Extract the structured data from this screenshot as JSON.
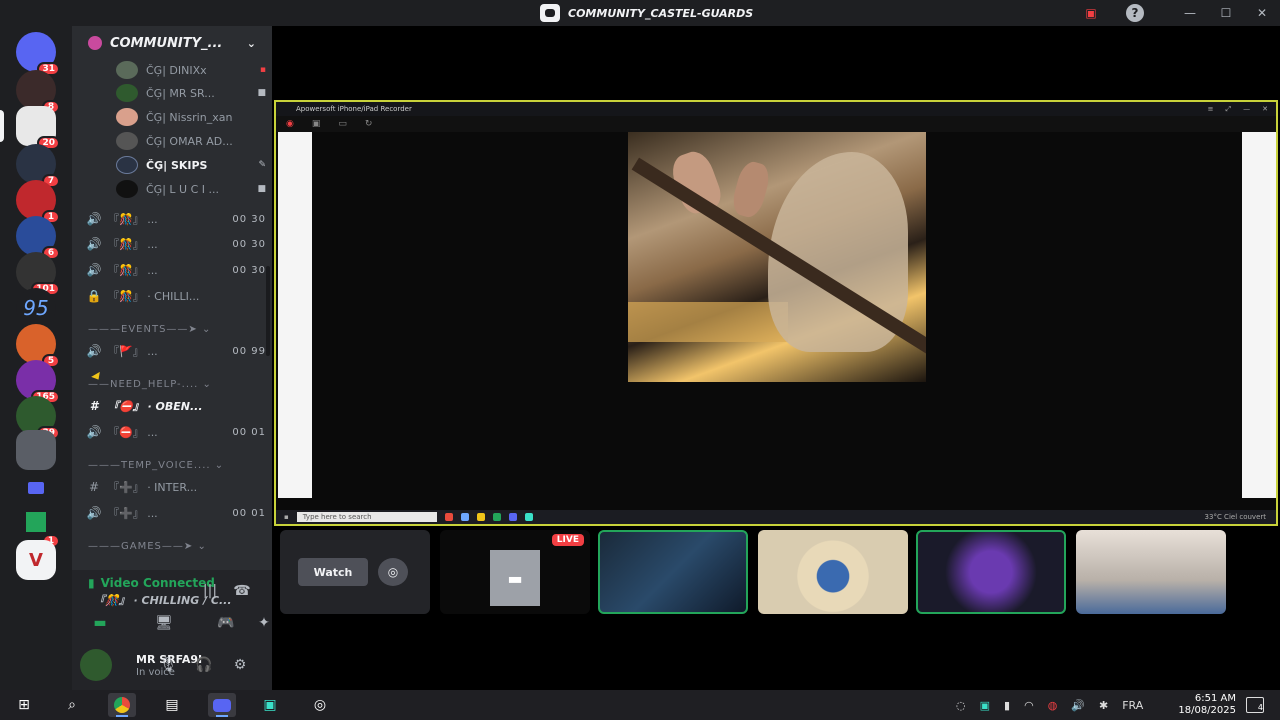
{
  "window": {
    "title": "COMMUNITY_CASTEL-GUARDS",
    "controls": {
      "minimize": "—",
      "maximize": "☐",
      "close": "✕"
    },
    "help": "?"
  },
  "servers": [
    {
      "name": "server-1",
      "badge": "31",
      "color": "#5865f2"
    },
    {
      "name": "server-2",
      "badge": "8",
      "color": "#3b2a2a"
    },
    {
      "name": "server-3",
      "badge": "20",
      "color": "#e8e8e8",
      "active": true
    },
    {
      "name": "server-4",
      "badge": "7",
      "color": "#2a3344"
    },
    {
      "name": "server-5",
      "badge": "1",
      "color": "#c0282d"
    },
    {
      "name": "server-6",
      "badge": "6",
      "color": "#2a4c9a"
    },
    {
      "name": "server-7",
      "badge": "101",
      "color": "#333"
    },
    {
      "name": "server-8",
      "badge": "",
      "color": "#1e1f22",
      "text": "95"
    },
    {
      "name": "server-9",
      "badge": "5",
      "color": "#d9622b"
    },
    {
      "name": "server-10",
      "badge": "165",
      "color": "#7a2fa8"
    },
    {
      "name": "server-11",
      "badge": "39",
      "color": "#2e5a2e"
    },
    {
      "name": "server-12",
      "badge": "",
      "color": "#5a5e66"
    },
    {
      "name": "server-13",
      "badge": "",
      "color": "#5865f2"
    },
    {
      "name": "server-14",
      "badge": "1",
      "color": "#23a55a"
    },
    {
      "name": "server-15",
      "badge": "",
      "color": "#f2f3f5"
    }
  ],
  "guild": {
    "name": "COMMUNITY_...",
    "chevron": "⌄"
  },
  "members": [
    {
      "name": "ČĢ| DINIXx"
    },
    {
      "name": "ČĢ| MR SR..."
    },
    {
      "name": "ČĢ| Nissrin_xan"
    },
    {
      "name": "ČĢ| OMAR AD..."
    },
    {
      "name": "ČĢ| SKIPS",
      "bold": true
    },
    {
      "name": "ČĢ| L U C I ..."
    }
  ],
  "channels": [
    {
      "icon": "🔊",
      "label": "『🎊』 ...",
      "count": "00 30"
    },
    {
      "icon": "🔊",
      "label": "『🎊』 ...",
      "count": "00 30"
    },
    {
      "icon": "🔊",
      "label": "『🎊』 ...",
      "count": "00 30"
    },
    {
      "icon": "🔒",
      "label": "『🎊』 · CHILLI...",
      "count": ""
    },
    {
      "icon": "🔊",
      "label": "『🚩』 ...",
      "count": "00 99"
    },
    {
      "icon": "#",
      "label": "『⛔』 · OBEN...",
      "count": "",
      "bold": true
    },
    {
      "icon": "🔊",
      "label": "『⛔』 ...",
      "count": "00 01"
    },
    {
      "icon": "#",
      "label": "『➕』 · INTER...",
      "count": ""
    },
    {
      "icon": "🔊",
      "label": "『➕』 ...",
      "count": "00 01"
    }
  ],
  "categories": {
    "events": "———EVENTS——➤ ⌄",
    "need_help": "——NEED_HELP-.... ⌄",
    "temp_voice": "———TEMP_VOICE.... ⌄",
    "games": "———GAMES——➤ ⌄"
  },
  "voice": {
    "status": "Video Connected",
    "channel": "『🎊』 · CHILLING / C...",
    "buttons": {
      "camera": "▬",
      "screen": "🖥",
      "activity": "🎮",
      "soundboard": "✦",
      "noise": "|||",
      "disconnect": "☎"
    }
  },
  "user": {
    "name": "MR SRFA9I",
    "status": "In voice"
  },
  "stream": {
    "recorder_title": "Apowersoft iPhone/iPad Recorder",
    "inner_search": "Type here to search",
    "inner_status": "33°C Ciel couvert"
  },
  "tiles": {
    "watch": "Watch",
    "live": "LIVE"
  },
  "taskbar": {
    "time": "6:51 AM",
    "date": "18/08/2025",
    "lang": "FRA",
    "notif_count": "4"
  }
}
